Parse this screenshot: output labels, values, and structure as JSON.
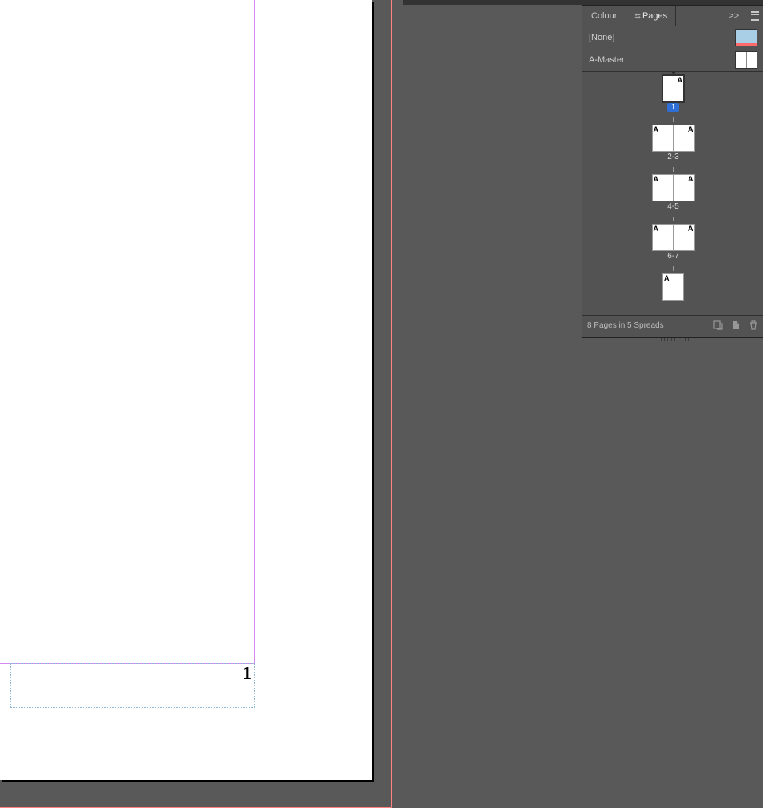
{
  "document": {
    "visible_page_number": "1"
  },
  "panel": {
    "tabs": {
      "colour": "Colour",
      "pages": "Pages"
    },
    "collapse_glyph": ">>",
    "masters": {
      "none": "[None]",
      "a_master": "A-Master"
    },
    "spreads": [
      {
        "pages": [
          {
            "master": "A",
            "side": "r",
            "selected": true
          }
        ],
        "label": "1",
        "start_of_section": true,
        "label_selected": true
      },
      {
        "pages": [
          {
            "master": "A",
            "side": "l"
          },
          {
            "master": "A",
            "side": "r"
          }
        ],
        "label": "2-3"
      },
      {
        "pages": [
          {
            "master": "A",
            "side": "l"
          },
          {
            "master": "A",
            "side": "r"
          }
        ],
        "label": "4-5"
      },
      {
        "pages": [
          {
            "master": "A",
            "side": "l"
          },
          {
            "master": "A",
            "side": "r"
          }
        ],
        "label": "6-7"
      },
      {
        "pages": [
          {
            "master": "A",
            "side": "l"
          }
        ],
        "label": ""
      }
    ],
    "footer": {
      "status": "8 Pages in 5 Spreads"
    }
  }
}
